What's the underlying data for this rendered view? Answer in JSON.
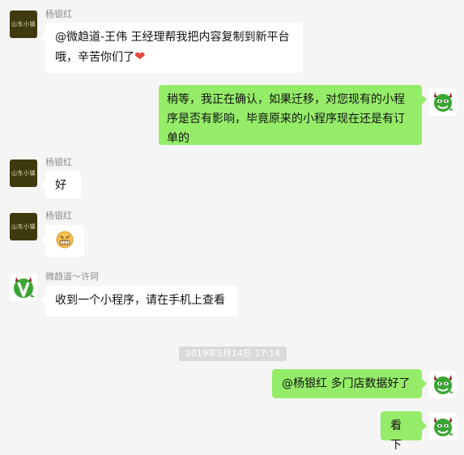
{
  "senders": {
    "yang": "杨银红",
    "xu": "微趋道～许珂"
  },
  "avatars": {
    "yang_logo_text": "山东小镇"
  },
  "messages": {
    "m1_text": "@微趋道-王伟 王经理帮我把内容复制到新平台哦，辛苦你们了",
    "m1_heart_icon": "heart-icon",
    "m2_text": "稍等，我正在确认，如果迁移，对您现有的小程序是否有影响，毕竟原来的小程序现在还是有订单的",
    "m3_text": "好",
    "m4_emoji": "grinning-face-icon",
    "m5_text": "收到一个小程序，请在手机上查看",
    "m6_text": "@杨银红 多门店数据好了",
    "m7_text": "看下"
  },
  "timestamp": "2019年5月14日 17:14",
  "colors": {
    "background": "#f5f5f5",
    "incoming_bubble": "#ffffff",
    "outgoing_bubble": "#95ec69",
    "timestamp_bg": "#dadada",
    "sender_name": "#8c8c8c"
  }
}
